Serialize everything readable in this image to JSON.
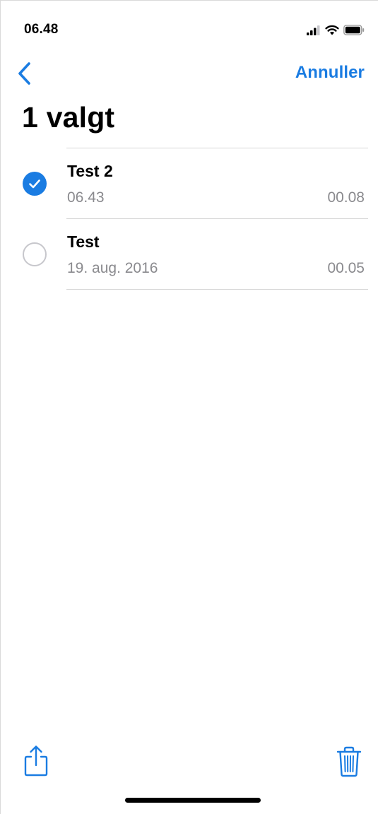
{
  "status_bar": {
    "time": "06.48",
    "icons": [
      "signal-icon",
      "wifi-icon",
      "battery-icon"
    ]
  },
  "nav": {
    "back_icon": "chevron-left-icon",
    "cancel_label": "Annuller"
  },
  "page_title": "1 valgt",
  "memos": [
    {
      "title": "Test 2",
      "date": "06.43",
      "duration": "00.08",
      "selected": true
    },
    {
      "title": "Test",
      "date": "19. aug. 2016",
      "duration": "00.05",
      "selected": false
    }
  ],
  "toolbar": {
    "share_icon": "share-icon",
    "trash_icon": "trash-icon"
  },
  "colors": {
    "accent": "#1a7ce2",
    "secondary_text": "#8a8a8e",
    "divider": "#d6d6d6"
  }
}
